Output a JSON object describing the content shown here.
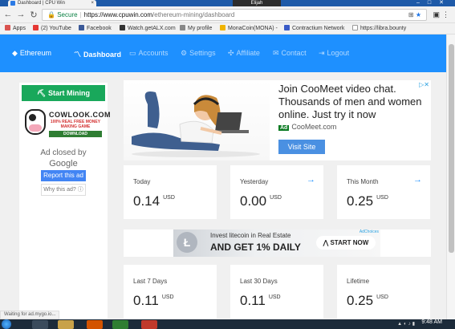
{
  "browser": {
    "tab_title": "Dashboard | CPU Win",
    "user_name": "Elijah",
    "secure_label": "Secure",
    "url_host": "https://www.cpuwin.com",
    "url_path": "/ethereum-mining/dashboard",
    "bookmarks": [
      "Apps",
      "(2) YouTube",
      "Facebook",
      "Watch.getALX.com",
      "My profile",
      "MonaCoin(MONA) - ",
      "Contractium Network",
      "https://libra.bounty"
    ]
  },
  "navbar": {
    "brand": "Ethereum",
    "items": [
      {
        "label": "Dashboard",
        "icon": "dashboard-icon"
      },
      {
        "label": "Accounts",
        "icon": "accounts-icon"
      },
      {
        "label": "Settings",
        "icon": "gear-icon"
      },
      {
        "label": "Affiliate",
        "icon": "network-icon"
      },
      {
        "label": "Contact",
        "icon": "envelope-icon"
      },
      {
        "label": "Logout",
        "icon": "logout-icon"
      }
    ]
  },
  "sidebar": {
    "start_mining": "Start Mining",
    "cow_ad_title": "COWLOOK.COM",
    "cow_ad_tagline": "100% REAL FREE MONEY MAKING GAME",
    "cow_ad_download": "DOWNLOAD",
    "ad_closed_by": "Ad closed by",
    "google": "Google",
    "report_ad": "Report this ad",
    "why_ad": "Why this ad?"
  },
  "top_ad": {
    "headline": "Join CooMeet video chat. Thousands of men and women online. Just try it now",
    "badge": "Ad",
    "domain": "CooMeet.com",
    "cta": "Visit Site"
  },
  "stats_row1": [
    {
      "label": "Today",
      "value": "0.14",
      "unit": "USD",
      "arrow": false
    },
    {
      "label": "Yesterday",
      "value": "0.00",
      "unit": "USD",
      "arrow": true
    },
    {
      "label": "This Month",
      "value": "0.25",
      "unit": "USD",
      "arrow": true
    }
  ],
  "banner_ad": {
    "line1": "Invest  litecoin  in Real Estate",
    "line2": "AND GET 1% DAILY",
    "cta": "START NOW",
    "choices": "AdChoices"
  },
  "stats_row2": [
    {
      "label": "Last 7 Days",
      "value": "0.11",
      "unit": "USD"
    },
    {
      "label": "Last 30 Days",
      "value": "0.11",
      "unit": "USD"
    },
    {
      "label": "Lifetime",
      "value": "0.25",
      "unit": "USD"
    }
  ],
  "status_text": "Waiting for ad.mygo.io...",
  "taskbar": {
    "time": "9:48 AM"
  }
}
